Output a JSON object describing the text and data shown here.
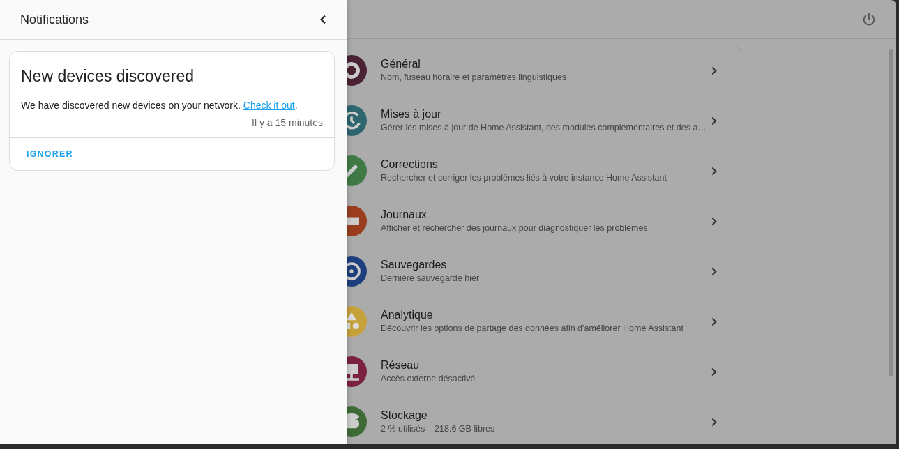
{
  "drawer": {
    "title": "Notifications",
    "notifications": [
      {
        "title": "New devices discovered",
        "message": "We have discovered new devices on your network. ",
        "link": "Check it out",
        "after_link": ".",
        "time": "Il y a 15 minutes",
        "actions": [
          "IGNORER"
        ]
      }
    ]
  },
  "settings": [
    {
      "kind": "gear",
      "title": "Général",
      "description": "Nom, fuseau horaire et paramètres linguistiques",
      "color": "#4a2234"
    },
    {
      "kind": "update",
      "title": "Mises à jour",
      "description": "Gérer les mises à jour de Home Assistant, des modules complémentaires et des a…",
      "color": "#2e6670"
    },
    {
      "kind": "wrench",
      "title": "Corrections",
      "description": "Rechercher et corriger les problèmes liés à votre instance Home Assistant",
      "color": "#3f7a46"
    },
    {
      "kind": "log",
      "title": "Journaux",
      "description": "Afficher et rechercher des journaux pour diagnostiquer les problèmes",
      "color": "#9a3e1f"
    },
    {
      "kind": "backup",
      "title": "Sauvegardes",
      "description": "Dernière sauvegarde hier",
      "color": "#1e3f7e"
    },
    {
      "kind": "shapes",
      "title": "Analytique",
      "description": "Découvrir les options de partage des données afin d'améliorer Home Assistant",
      "color": "#c6a13c"
    },
    {
      "kind": "network",
      "title": "Réseau",
      "description": "Accès externe désactivé",
      "color": "#7b2142"
    },
    {
      "kind": "storage",
      "title": "Stockage",
      "description": "2 % utilisés – 218.6 GB libres",
      "color": "#3e6b36"
    }
  ]
}
